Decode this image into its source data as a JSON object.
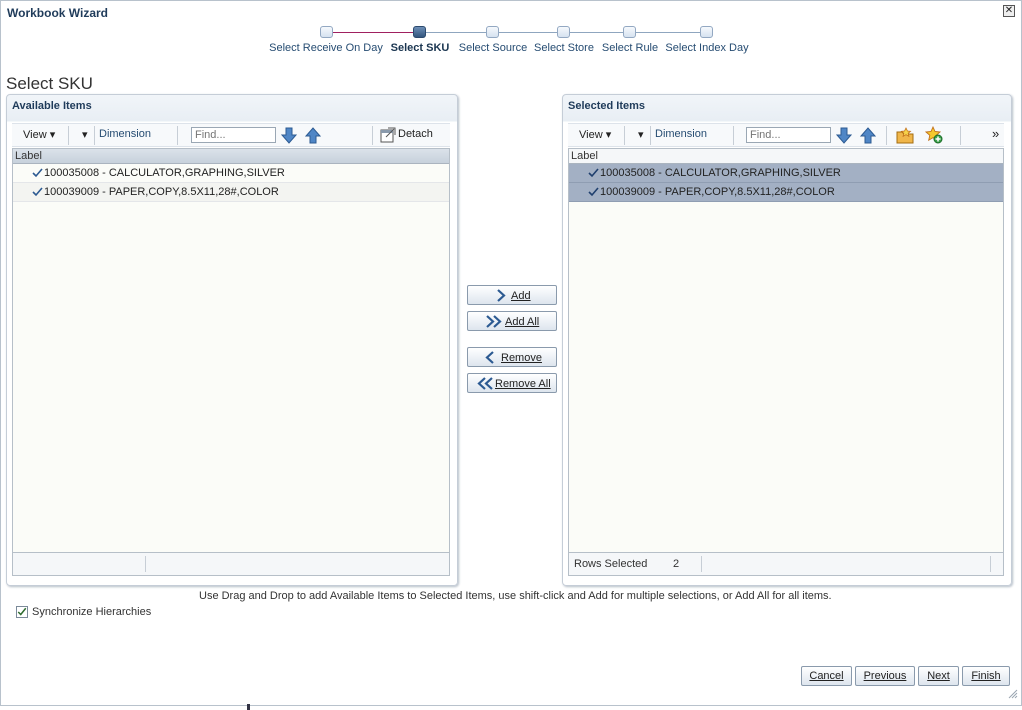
{
  "dialog": {
    "title": "Workbook Wizard",
    "close_icon": "close-icon"
  },
  "train": {
    "steps": [
      {
        "label": "Select Receive On Day",
        "state": "visited"
      },
      {
        "label": "Select SKU",
        "state": "current"
      },
      {
        "label": "Select Source",
        "state": "pending"
      },
      {
        "label": "Select Store",
        "state": "pending"
      },
      {
        "label": "Select Rule",
        "state": "pending"
      },
      {
        "label": "Select Index Day",
        "state": "pending"
      }
    ]
  },
  "page_title": "Select SKU",
  "available": {
    "header": "Available Items",
    "toolbar": {
      "view": "View",
      "dimension": "Dimension",
      "find_placeholder": "Find...",
      "detach": "Detach"
    },
    "column": "Label",
    "rows": [
      "100035008 - CALCULATOR,GRAPHING,SILVER",
      "100039009 - PAPER,COPY,8.5X11,28#,COLOR"
    ]
  },
  "selected": {
    "header": "Selected Items",
    "toolbar": {
      "view": "View",
      "dimension": "Dimension",
      "find_placeholder": "Find...",
      "more": "»"
    },
    "column": "Label",
    "rows": [
      "100035008 - CALCULATOR,GRAPHING,SILVER",
      "100039009 - PAPER,COPY,8.5X11,28#,COLOR"
    ],
    "status": {
      "label": "Rows Selected",
      "count": "2"
    }
  },
  "shuttle": {
    "add": "Add",
    "add_all": "Add All",
    "remove": "Remove",
    "remove_all": "Remove All"
  },
  "hint": "Use Drag and Drop to add Available Items to Selected Items, use shift-click and Add for multiple selections, or Add All for all items.",
  "synchronize": {
    "label": "Synchronize Hierarchies",
    "checked": true
  },
  "footer": {
    "cancel": "Cancel",
    "previous": "Previous",
    "next": "Next",
    "finish": "Finish"
  },
  "colors": {
    "accent": "#1f3b5a",
    "selected_row": "#a3b0c4",
    "train_current": "#34577f",
    "train_done_line": "#a02060"
  }
}
